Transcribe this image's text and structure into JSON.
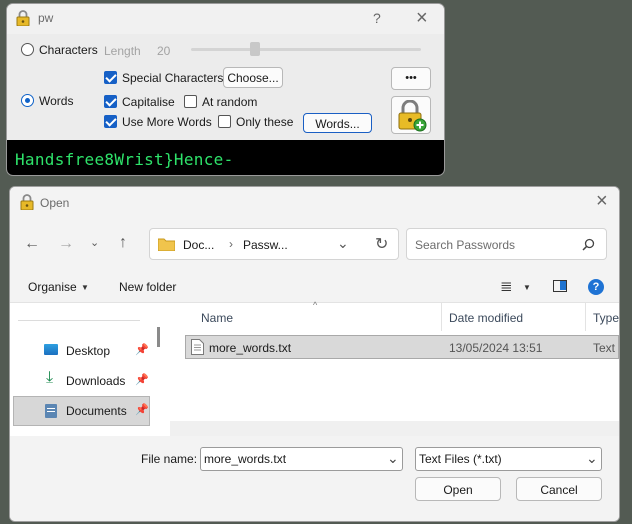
{
  "pw_window": {
    "title": "pw",
    "help_glyph": "?",
    "close_glyph": "×",
    "characters_label": "Characters",
    "length_label": "Length",
    "length_value": "20",
    "length_slider_fraction": 0.27,
    "words_label": "Words",
    "special_characters_label": "Special Characters",
    "choose_button": "Choose...",
    "more_button": "•••",
    "capitalise_label": "Capitalise",
    "at_random_label": "At random",
    "use_more_words_label": "Use More Words",
    "only_these_label": "Only these",
    "words_button": "Words...",
    "output": "Handsfree8Wrist}Hence-",
    "mode_selected": "Words",
    "checkboxes": {
      "special_characters": true,
      "capitalise": true,
      "at_random": false,
      "use_more_words": true,
      "only_these": false
    }
  },
  "open_dialog": {
    "title": "Open",
    "breadcrumb": [
      "Doc...",
      "Passw..."
    ],
    "search_placeholder": "Search Passwords",
    "organise_label": "Organise",
    "new_folder_label": "New folder",
    "sidebar": [
      {
        "label": "Desktop",
        "icon": "desktop-icon",
        "selected": false
      },
      {
        "label": "Downloads",
        "icon": "download-icon",
        "selected": false
      },
      {
        "label": "Documents",
        "icon": "documents-icon",
        "selected": true
      }
    ],
    "columns": [
      "Name",
      "Date modified",
      "Type"
    ],
    "files": [
      {
        "name": "more_words.txt",
        "date": "13/05/2024 13:51",
        "type": "Text D"
      }
    ],
    "file_name_label": "File name:",
    "file_name_value": "more_words.txt",
    "file_type_value": "Text Files (*.txt)",
    "open_button": "Open",
    "cancel_button": "Cancel"
  },
  "colors": {
    "accent": "#1660c6",
    "terminal_text": "#2ee36a",
    "desktop_bg": "#535b53"
  }
}
